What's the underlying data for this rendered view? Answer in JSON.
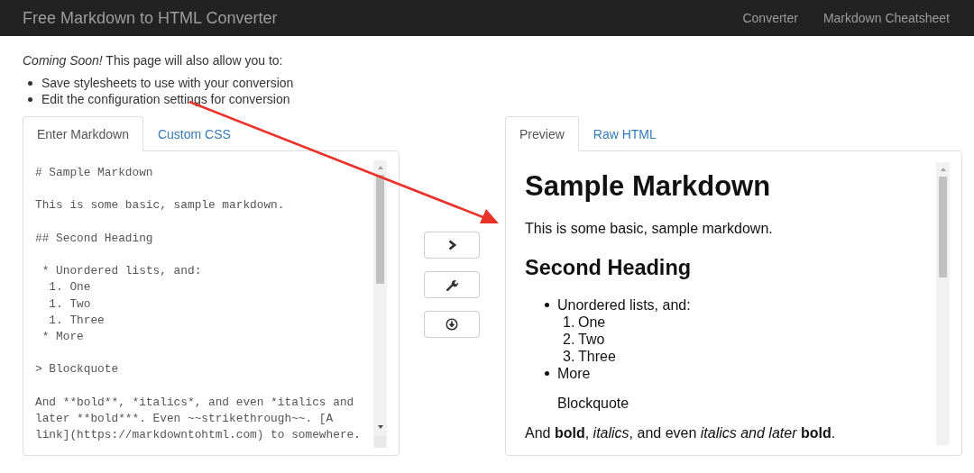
{
  "navbar": {
    "title": "Free Markdown to HTML Converter",
    "links": [
      {
        "label": "Converter"
      },
      {
        "label": "Markdown Cheatsheet"
      }
    ]
  },
  "intro": {
    "coming_soon": "*Coming Soon!* This page will also allow you to:",
    "features": [
      "Save stylesheets to use with your conversion",
      "Edit the configuration settings for conversion"
    ]
  },
  "editor": {
    "tabs": [
      {
        "label": "Enter Markdown",
        "selected": true
      },
      {
        "label": "Custom CSS",
        "selected": false
      }
    ],
    "markdown": "# Sample Markdown\n\nThis is some basic, sample markdown.\n\n## Second Heading\n\n * Unordered lists, and:\n  1. One\n  1. Two\n  1. Three\n * More\n\n> Blockquote\n\nAnd **bold**, *italics*, and even *italics and later **bold***. Even ~~strikethrough~~. [A link](https://markdowntohtml.com) to somewhere."
  },
  "actions": [
    {
      "kind": "convert"
    },
    {
      "kind": "settings"
    },
    {
      "kind": "download"
    }
  ],
  "preview": {
    "tabs": [
      {
        "label": "Preview",
        "selected": true
      },
      {
        "label": "Raw HTML",
        "selected": false
      }
    ],
    "content": [
      {
        "kind": "h1",
        "text": "Sample Markdown"
      },
      {
        "kind": "p",
        "text": "This is some basic, sample markdown."
      },
      {
        "kind": "h2",
        "text": "Second Heading"
      },
      {
        "kind": "ul",
        "items": [
          {
            "text": "Unordered lists, and:",
            "children": [
              {
                "number": "1.",
                "text": "One"
              },
              {
                "number": "2.",
                "text": "Two"
              },
              {
                "number": "3.",
                "text": "Three"
              }
            ]
          },
          {
            "text": "More"
          }
        ]
      },
      {
        "kind": "blockquote",
        "text": "Blockquote"
      },
      {
        "kind": "p",
        "text": "And **bold**, *italics*, and even *italics and later* **bold**."
      }
    ]
  }
}
